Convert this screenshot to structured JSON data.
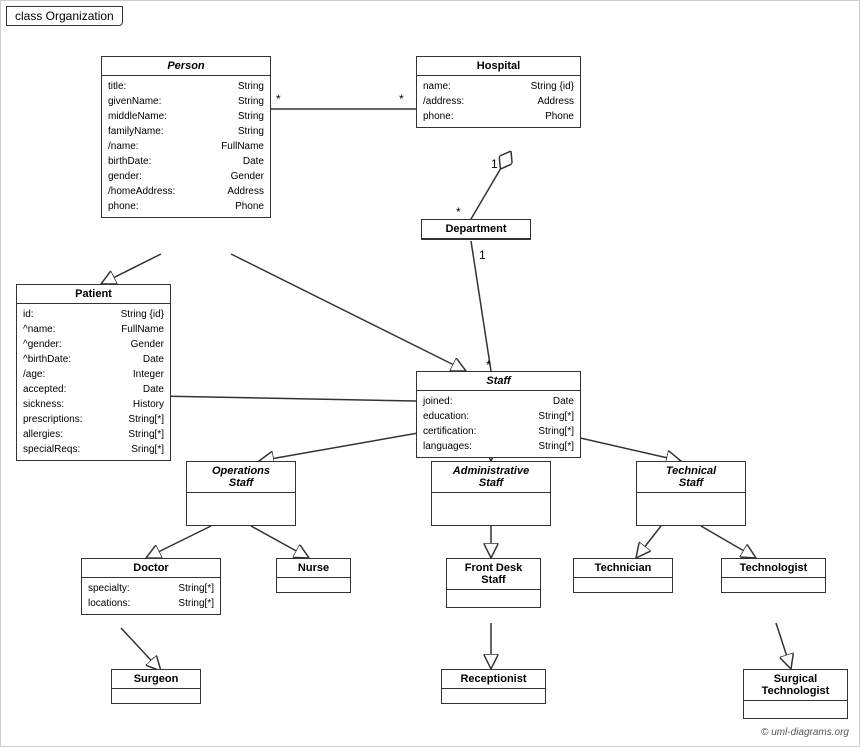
{
  "title": "class Organization",
  "copyright": "© uml-diagrams.org",
  "boxes": {
    "person": {
      "name": "Person",
      "italic": true,
      "attrs": [
        [
          "title:",
          "String"
        ],
        [
          "givenName:",
          "String"
        ],
        [
          "middleName:",
          "String"
        ],
        [
          "familyName:",
          "String"
        ],
        [
          "/name:",
          "FullName"
        ],
        [
          "birthDate:",
          "Date"
        ],
        [
          "gender:",
          "Gender"
        ],
        [
          "/homeAddress:",
          "Address"
        ],
        [
          "phone:",
          "Phone"
        ]
      ]
    },
    "hospital": {
      "name": "Hospital",
      "italic": false,
      "attrs": [
        [
          "name:",
          "String {id}"
        ],
        [
          "/address:",
          "Address"
        ],
        [
          "phone:",
          "Phone"
        ]
      ]
    },
    "patient": {
      "name": "Patient",
      "italic": false,
      "attrs": [
        [
          "id:",
          "String {id}"
        ],
        [
          "^name:",
          "FullName"
        ],
        [
          "^gender:",
          "Gender"
        ],
        [
          "^birthDate:",
          "Date"
        ],
        [
          "/age:",
          "Integer"
        ],
        [
          "accepted:",
          "Date"
        ],
        [
          "sickness:",
          "History"
        ],
        [
          "prescriptions:",
          "String[*]"
        ],
        [
          "allergies:",
          "String[*]"
        ],
        [
          "specialReqs:",
          "Sring[*]"
        ]
      ]
    },
    "department": {
      "name": "Department",
      "italic": false,
      "attrs": []
    },
    "staff": {
      "name": "Staff",
      "italic": true,
      "attrs": [
        [
          "joined:",
          "Date"
        ],
        [
          "education:",
          "String[*]"
        ],
        [
          "certification:",
          "String[*]"
        ],
        [
          "languages:",
          "String[*]"
        ]
      ]
    },
    "operations_staff": {
      "name": "Operations\nStaff",
      "italic": true,
      "attrs": []
    },
    "administrative_staff": {
      "name": "Administrative\nStaff",
      "italic": true,
      "attrs": []
    },
    "technical_staff": {
      "name": "Technical\nStaff",
      "italic": true,
      "attrs": []
    },
    "doctor": {
      "name": "Doctor",
      "italic": false,
      "attrs": [
        [
          "specialty:",
          "String[*]"
        ],
        [
          "locations:",
          "String[*]"
        ]
      ]
    },
    "nurse": {
      "name": "Nurse",
      "italic": false,
      "attrs": []
    },
    "front_desk_staff": {
      "name": "Front Desk\nStaff",
      "italic": false,
      "attrs": []
    },
    "technician": {
      "name": "Technician",
      "italic": false,
      "attrs": []
    },
    "technologist": {
      "name": "Technologist",
      "italic": false,
      "attrs": []
    },
    "surgeon": {
      "name": "Surgeon",
      "italic": false,
      "attrs": []
    },
    "receptionist": {
      "name": "Receptionist",
      "italic": false,
      "attrs": []
    },
    "surgical_technologist": {
      "name": "Surgical\nTechnologist",
      "italic": false,
      "attrs": []
    }
  }
}
